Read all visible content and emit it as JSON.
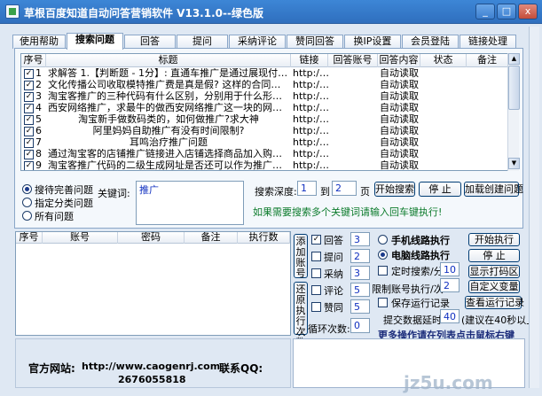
{
  "window": {
    "title": "草根百度知道自动问答营销软件 V13.1.0--绿色版",
    "minimize": "_",
    "maximize": "□",
    "close": "x"
  },
  "tabs": [
    "使用帮助",
    "搜索问题",
    "回答",
    "提问",
    "采纳评论",
    "赞同回答",
    "换IP设置",
    "会员登陆",
    "链接处理"
  ],
  "active_tab": "搜索问题",
  "table": {
    "columns": [
      "序号",
      "标题",
      "链接",
      "回答账号",
      "回答内容",
      "状态",
      "备注"
    ],
    "rows": [
      {
        "n": "1",
        "title": "求解答 1.【判断题 - 1分】: 直通车推广是通过展现付…",
        "link": "http:/…",
        "account": "",
        "content": "自动读取",
        "status": "",
        "note": ""
      },
      {
        "n": "2",
        "title": "文化传播公司收取模特推广费是真是假? 这样的合同…",
        "link": "http:/…",
        "account": "",
        "content": "自动读取",
        "status": "",
        "note": ""
      },
      {
        "n": "3",
        "title": "淘宝客推广的三种代码有什么区别，分别用于什么形…",
        "link": "http:/…",
        "account": "",
        "content": "自动读取",
        "status": "",
        "note": ""
      },
      {
        "n": "4",
        "title": "西安网络推广，求最牛的做西安网络推广这一块的网…",
        "link": "http:/…",
        "account": "",
        "content": "自动读取",
        "status": "",
        "note": ""
      },
      {
        "n": "5",
        "title": "淘宝新手做数码类的，如何做推广?求大神",
        "link": "http:/…",
        "account": "",
        "content": "自动读取",
        "status": "",
        "note": ""
      },
      {
        "n": "6",
        "title": "阿里妈妈自助推广有没有时间限制?",
        "link": "http:/…",
        "account": "",
        "content": "自动读取",
        "status": "",
        "note": ""
      },
      {
        "n": "7",
        "title": "耳鸣治疗推广问题",
        "link": "http:/…",
        "account": "",
        "content": "自动读取",
        "status": "",
        "note": ""
      },
      {
        "n": "8",
        "title": "通过淘宝客的店铺推广链接进入店铺选择商品加入购…",
        "link": "http:/…",
        "account": "",
        "content": "自动读取",
        "status": "",
        "note": ""
      },
      {
        "n": "9",
        "title": "淘宝客推广代码的二级生成网址是否还可以作为推广…",
        "link": "http:/…",
        "account": "",
        "content": "自动读取",
        "status": "",
        "note": ""
      }
    ]
  },
  "search_options": {
    "radio1": "搜待完善问题",
    "radio2": "指定分类问题",
    "radio3": "所有问题",
    "keyword_label": "关键词:",
    "keyword_value": "推广",
    "depth_label": "搜索深度:",
    "depth_from": "1",
    "depth_to_label": "到",
    "depth_to": "2",
    "depth_unit": "页",
    "start_search": "开始搜索",
    "stop": "停 止",
    "load_questions": "加载创建问题",
    "hint": "如果需要搜索多个关键词请输入回车键执行!"
  },
  "account_table": {
    "columns": [
      "序号",
      "账号",
      "密码",
      "备注",
      "执行数"
    ]
  },
  "side_buttons": {
    "add_account": "添加账号",
    "restore_count": "还原执行次数"
  },
  "tasks": [
    {
      "label": "回答",
      "value": "3",
      "checked": true
    },
    {
      "label": "提问",
      "value": "2",
      "checked": false
    },
    {
      "label": "采纳",
      "value": "3",
      "checked": false
    },
    {
      "label": "评论",
      "value": "5",
      "checked": false
    },
    {
      "label": "赞同",
      "value": "5",
      "checked": false
    }
  ],
  "loop": {
    "label": "循环次数:",
    "value": "0"
  },
  "route": {
    "mobile": "手机线路执行",
    "pc": "电脑线路执行",
    "timed_search": "定时搜索/分",
    "timed_value": "10",
    "limit_label": "限制账号执行/次",
    "limit_value": "2",
    "save_log": "保存运行记录",
    "delay_label": "提交数据延时:",
    "delay_value": "40",
    "delay_note": "(建议在40秒以上)"
  },
  "actions": {
    "start": "开始执行",
    "stop": "停 止",
    "show_captcha": "显示打码区",
    "custom_vars": "自定义变量",
    "view_log": "查看运行记录"
  },
  "more_ops": "更多操作请在列表点击鼠标右键",
  "footer": {
    "website_label": "官方网站:",
    "website": "http://www.caogenrj.com",
    "qq_label": "联系QQ:",
    "qq": "2676055818"
  },
  "watermark": "jz5u.com",
  "colors": {
    "titlebar": "#2f6fbe",
    "hint": "#0a7a2a",
    "accent_text": "#1030c0"
  }
}
